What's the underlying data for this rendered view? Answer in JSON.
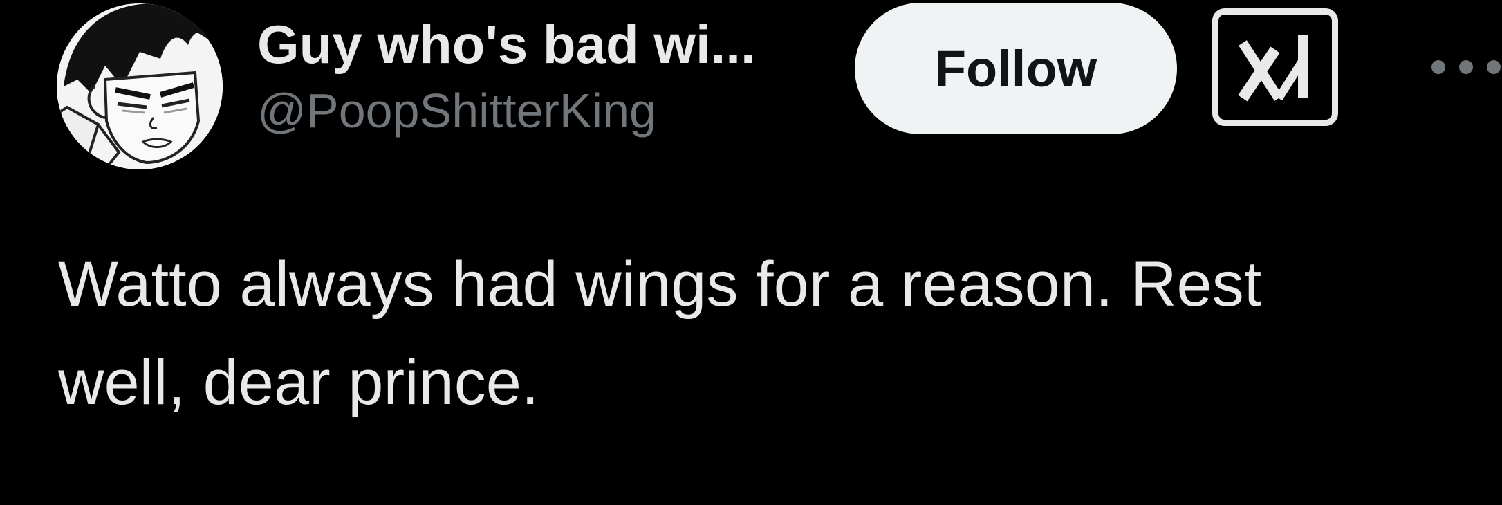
{
  "tweet": {
    "author": {
      "display_name": "Guy who's bad wi...",
      "handle": "@PoopShitterKing",
      "avatar_icon": "manga-character-avatar"
    },
    "follow_button_label": "Follow",
    "grok_icon": "x-ai-logo-icon",
    "more_icon": "more-options-icon",
    "text_line_1": "Watto always had wings for a reason. Rest",
    "text_line_2": "well, dear prince."
  },
  "colors": {
    "background": "#000000",
    "primary_text": "#e7e9ea",
    "secondary_text": "#71767b",
    "follow_button_bg": "#eff3f4",
    "follow_button_text": "#0f1419"
  }
}
